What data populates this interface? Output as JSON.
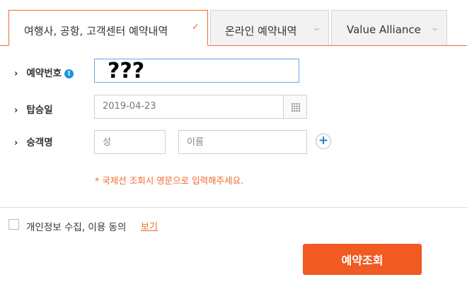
{
  "tabs": [
    {
      "label": "여행사, 공항, 고객센터 예약내역",
      "active": true
    },
    {
      "label": "온라인 예약내역",
      "active": false
    },
    {
      "label": "Value Alliance",
      "active": false
    }
  ],
  "icons": {
    "tab_chevron": "chevron-down-icon",
    "active_check": "check-icon",
    "row_arrow": "chevron-right-icon",
    "info": "info-icon",
    "calendar": "calendar-icon",
    "add": "plus-circle-icon"
  },
  "glyphs": {
    "check": "✓",
    "chevron": "⌄",
    "arrow": "›",
    "info": "!",
    "plus": "+"
  },
  "form": {
    "reservation_label": "예약번호",
    "reservation_value": "???",
    "date_label": "탑승일",
    "date_value": "2019-04-23",
    "name_label": "승객명",
    "surname_placeholder": "성",
    "given_name_placeholder": "이름",
    "note": "* 국제선 조회시 영문으로 입력해주세요."
  },
  "consent": {
    "label": "개인정보 수집, 이용 동의",
    "view_link": "보기",
    "checked": false
  },
  "submit_label": "예약조회",
  "colors": {
    "accent": "#f06a2b",
    "button": "#f15a22",
    "info": "#1e96dc"
  }
}
